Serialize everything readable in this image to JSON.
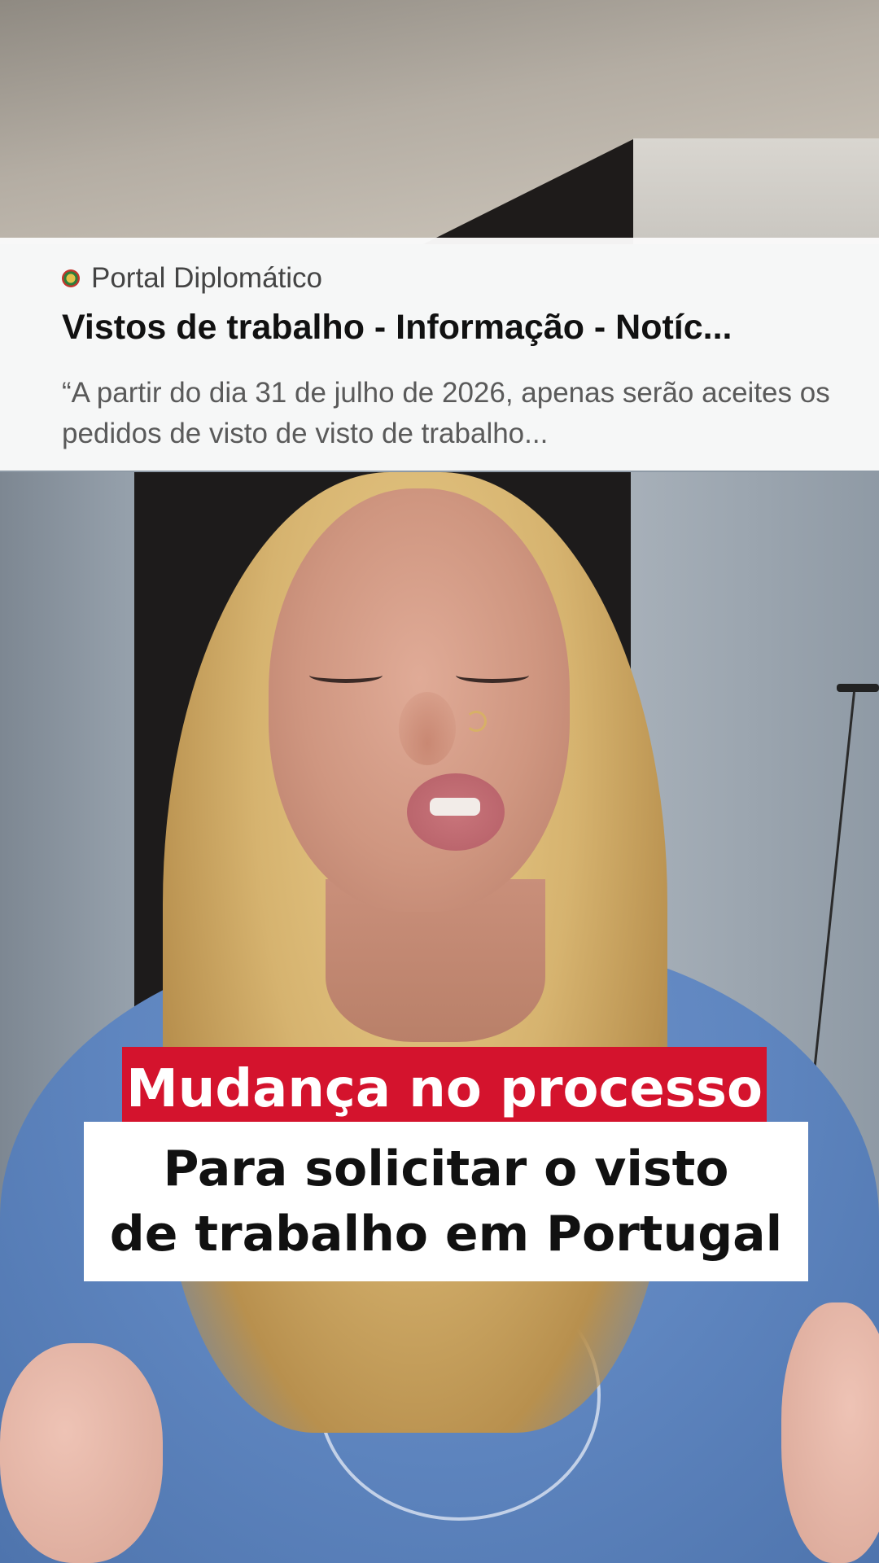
{
  "news_card": {
    "source": "Portal Diplomático",
    "title": "Vistos de trabalho - Informação - Notíc...",
    "snippet": "“A partir do dia 31 de julho de 2026, apenas serão aceites os pedidos de visto de visto de trabalho..."
  },
  "captions": {
    "headline": "Mudança no processo",
    "line1": "Para solicitar o visto",
    "line2": "de trabalho em Portugal"
  },
  "colors": {
    "headline_bg": "#d4132d",
    "caption_bg": "#ffffff",
    "shirt": "#5f86c0"
  },
  "icons": {
    "source_icon": "portugal-coat-of-arms-icon"
  }
}
